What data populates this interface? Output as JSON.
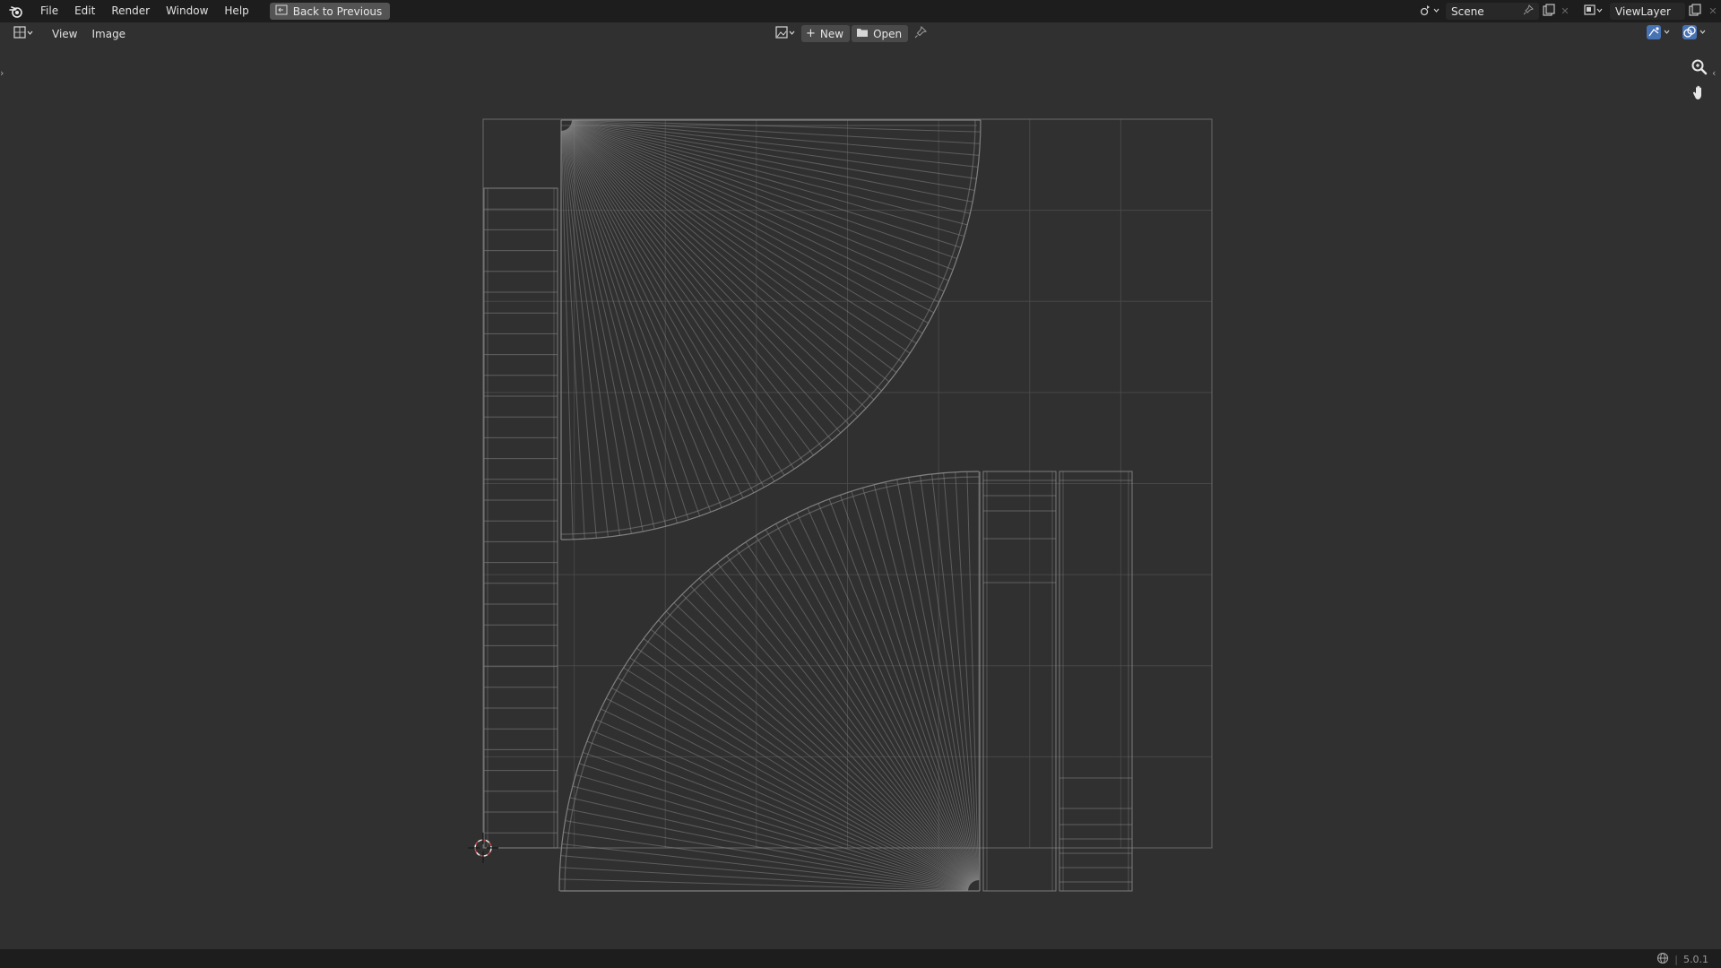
{
  "topbar": {
    "menus": [
      "File",
      "Edit",
      "Render",
      "Window",
      "Help"
    ],
    "back_label": "Back to Previous",
    "scene_name": "Scene",
    "view_layer_name": "ViewLayer"
  },
  "editor_header": {
    "menus": [
      "View",
      "Image"
    ],
    "new_label": "New",
    "open_label": "Open"
  },
  "statusbar": {
    "version": "5.0.1"
  },
  "colors": {
    "topbar_bg": "#1d1d1d",
    "editor_bg": "#303030",
    "uv_wire": "#8a8a8a",
    "cursor_red": "#d04545"
  },
  "icons": [
    "blender-logo-icon",
    "back-icon",
    "scene-icon",
    "pin-icon",
    "copy-icon",
    "close-icon",
    "view-layer-icon",
    "editor-type-icon",
    "image-icon",
    "plus-icon",
    "folder-icon",
    "zoom-icon",
    "hand-icon",
    "uv-sync-icon",
    "overlay-icon",
    "globe-icon"
  ]
}
